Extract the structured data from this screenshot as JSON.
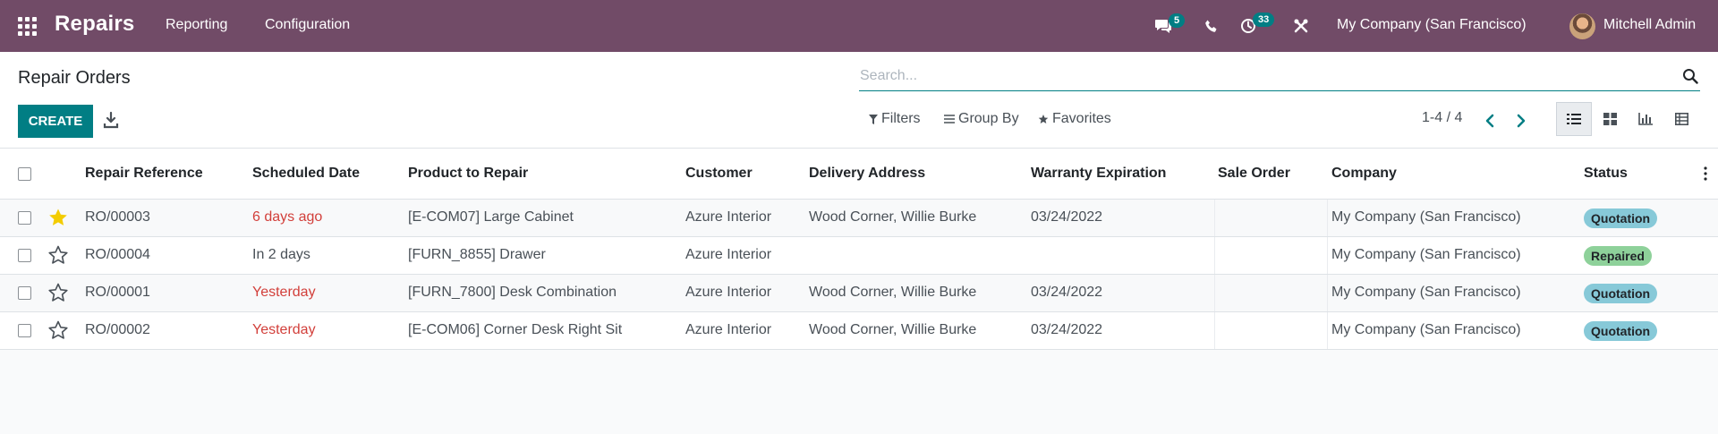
{
  "navbar": {
    "brand": "Repairs",
    "menus": [
      "Reporting",
      "Configuration"
    ],
    "messages_count": "5",
    "activities_count": "33",
    "company": "My Company (San Francisco)",
    "user": "Mitchell Admin",
    "color": "#714b67"
  },
  "control_panel": {
    "title": "Repair Orders",
    "create_label": "CREATE",
    "search_placeholder": "Search...",
    "filters_label": "Filters",
    "group_by_label": "Group By",
    "favorites_label": "Favorites",
    "pager": "1-4 / 4",
    "accent": "#017e84"
  },
  "table": {
    "columns": [
      "Repair Reference",
      "Scheduled Date",
      "Product to Repair",
      "Customer",
      "Delivery Address",
      "Warranty Expiration",
      "Sale Order",
      "Company",
      "Status"
    ],
    "rows": [
      {
        "starred": true,
        "ref": "RO/00003",
        "date": "6 days ago",
        "date_late": true,
        "product": "[E-COM07] Large Cabinet",
        "customer": "Azure Interior",
        "address": "Wood Corner, Willie Burke",
        "warranty": "03/24/2022",
        "sale_order": "",
        "company": "My Company (San Francisco)",
        "status": "Quotation",
        "status_color": "#87c9d8"
      },
      {
        "starred": false,
        "ref": "RO/00004",
        "date": "In 2 days",
        "date_late": false,
        "product": "[FURN_8855] Drawer",
        "customer": "Azure Interior",
        "address": "",
        "warranty": "",
        "sale_order": "",
        "company": "My Company (San Francisco)",
        "status": "Repaired",
        "status_color": "#8ed19a"
      },
      {
        "starred": false,
        "ref": "RO/00001",
        "date": "Yesterday",
        "date_late": true,
        "product": "[FURN_7800] Desk Combination",
        "customer": "Azure Interior",
        "address": "Wood Corner, Willie Burke",
        "warranty": "03/24/2022",
        "sale_order": "",
        "company": "My Company (San Francisco)",
        "status": "Quotation",
        "status_color": "#87c9d8"
      },
      {
        "starred": false,
        "ref": "RO/00002",
        "date": "Yesterday",
        "date_late": true,
        "product": "[E-COM06] Corner Desk Right Sit",
        "customer": "Azure Interior",
        "address": "Wood Corner, Willie Burke",
        "warranty": "03/24/2022",
        "sale_order": "",
        "company": "My Company (San Francisco)",
        "status": "Quotation",
        "status_color": "#87c9d8"
      }
    ]
  },
  "icons": [
    "apps-icon",
    "chat-icon",
    "phone-icon",
    "clock-icon",
    "tools-icon",
    "download-icon",
    "search-icon",
    "filter-icon",
    "group-by-icon",
    "star-icon",
    "chevron-left-icon",
    "chevron-right-icon",
    "list-view-icon",
    "kanban-view-icon",
    "graph-view-icon",
    "pivot-view-icon",
    "kebab-icon"
  ]
}
